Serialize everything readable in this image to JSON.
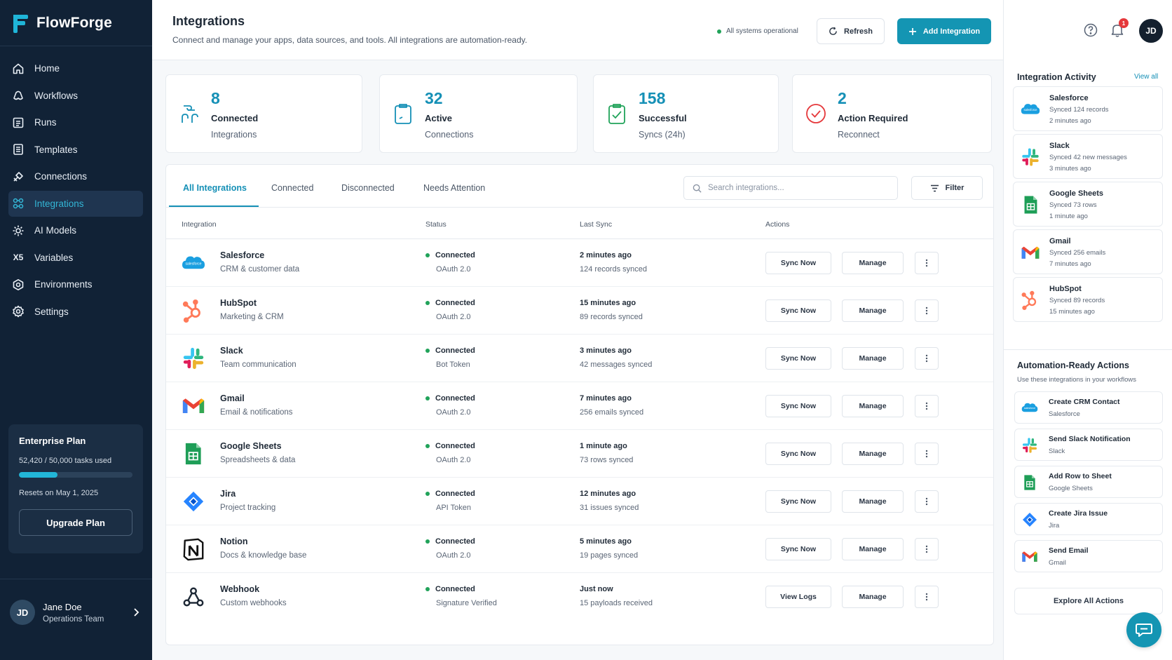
{
  "app": {
    "name": "FlowForge",
    "accent": "#1590b6",
    "sidebar_bg": "#112236"
  },
  "nav": [
    {
      "label": "Home",
      "icon": "home-icon",
      "active": false
    },
    {
      "label": "Workflows",
      "icon": "workflows-icon",
      "active": false
    },
    {
      "label": "Runs",
      "icon": "runs-icon",
      "active": false
    },
    {
      "label": "Templates",
      "icon": "templates-icon",
      "active": false
    },
    {
      "label": "Connections",
      "icon": "connections-icon",
      "active": false
    },
    {
      "label": "Integrations",
      "icon": "integrations-icon",
      "active": true
    },
    {
      "label": "AI Models",
      "icon": "ai-models-icon",
      "active": false
    },
    {
      "label": "Variables",
      "icon": "variables-icon",
      "glyph": "X5",
      "active": false
    },
    {
      "label": "Environments",
      "icon": "environments-icon",
      "active": false
    },
    {
      "label": "Settings",
      "icon": "settings-icon",
      "active": false
    }
  ],
  "plan": {
    "title": "Enterprise Plan",
    "usage": "52,420 / 50,000 tasks used",
    "progress_fraction": 0.34,
    "reset": "Resets on May 1, 2025",
    "button": "Upgrade Plan"
  },
  "user": {
    "initials": "JD",
    "name": "Jane Doe",
    "team": "Operations Team"
  },
  "header": {
    "title": "Integrations",
    "subtitle": "Connect and manage your apps, data sources, and tools. All integrations are automation-ready.",
    "status": "All systems operational",
    "refresh": "Refresh",
    "add": "Add Integration",
    "notifications": "1",
    "avatar": "JD"
  },
  "stats": [
    {
      "value": "8",
      "label": "Connected",
      "sub": "Integrations",
      "icon": "link-icon"
    },
    {
      "value": "32",
      "label": "Active",
      "sub": "Connections",
      "icon": "clipboard-icon"
    },
    {
      "value": "158",
      "label": "Successful",
      "sub": "Syncs (24h)",
      "icon": "clipboard-check-icon"
    },
    {
      "value": "2",
      "label": "Action Required",
      "sub": "Reconnect",
      "icon": "check-circle-icon"
    }
  ],
  "tabs": [
    "All Integrations",
    "Connected",
    "Disconnected",
    "Needs Attention"
  ],
  "search_placeholder": "Search integrations...",
  "filter": "Filter",
  "columns": [
    "Integration",
    "Status",
    "Last Sync",
    "Actions"
  ],
  "rows": [
    {
      "name": "Salesforce",
      "desc": "CRM & customer data",
      "status": "Connected",
      "auth": "OAuth 2.0",
      "sync": "2 minutes ago",
      "synced": "124 records synced",
      "action": "Sync Now",
      "manage": "Manage",
      "logo": "salesforce"
    },
    {
      "name": "HubSpot",
      "desc": "Marketing & CRM",
      "status": "Connected",
      "auth": "OAuth 2.0",
      "sync": "15 minutes ago",
      "synced": "89 records synced",
      "action": "Sync Now",
      "manage": "Manage",
      "logo": "hubspot"
    },
    {
      "name": "Slack",
      "desc": "Team communication",
      "status": "Connected",
      "auth": "Bot Token",
      "sync": "3 minutes ago",
      "synced": "42 messages synced",
      "action": "Sync Now",
      "manage": "Manage",
      "logo": "slack"
    },
    {
      "name": "Gmail",
      "desc": "Email & notifications",
      "status": "Connected",
      "auth": "OAuth 2.0",
      "sync": "7 minutes ago",
      "synced": "256 emails synced",
      "action": "Sync Now",
      "manage": "Manage",
      "logo": "gmail"
    },
    {
      "name": "Google Sheets",
      "desc": "Spreadsheets & data",
      "status": "Connected",
      "auth": "OAuth 2.0",
      "sync": "1 minute ago",
      "synced": "73 rows synced",
      "action": "Sync Now",
      "manage": "Manage",
      "logo": "sheets"
    },
    {
      "name": "Jira",
      "desc": "Project tracking",
      "status": "Connected",
      "auth": "API Token",
      "sync": "12 minutes ago",
      "synced": "31 issues synced",
      "action": "Sync Now",
      "manage": "Manage",
      "logo": "jira"
    },
    {
      "name": "Notion",
      "desc": "Docs & knowledge base",
      "status": "Connected",
      "auth": "OAuth 2.0",
      "sync": "5 minutes ago",
      "synced": "19 pages synced",
      "action": "Sync Now",
      "manage": "Manage",
      "logo": "notion"
    },
    {
      "name": "Webhook",
      "desc": "Custom webhooks",
      "status": "Connected",
      "auth": "Signature Verified",
      "sync": "Just now",
      "synced": "15 payloads received",
      "action": "View Logs",
      "manage": "Manage",
      "logo": "webhook"
    }
  ],
  "activity": {
    "title": "Integration Activity",
    "view_all": "View all",
    "items": [
      {
        "name": "Salesforce",
        "desc": "Synced 124 records",
        "time": "2 minutes ago",
        "logo": "salesforce"
      },
      {
        "name": "Slack",
        "desc": "Synced 42 new messages",
        "time": "3 minutes ago",
        "logo": "slack"
      },
      {
        "name": "Google Sheets",
        "desc": "Synced 73 rows",
        "time": "1 minute ago",
        "logo": "sheets"
      },
      {
        "name": "Gmail",
        "desc": "Synced 256 emails",
        "time": "7 minutes ago",
        "logo": "gmail"
      },
      {
        "name": "HubSpot",
        "desc": "Synced 89 records",
        "time": "15 minutes ago",
        "logo": "hubspot"
      }
    ]
  },
  "actions": {
    "title": "Automation-Ready Actions",
    "subtitle": "Use these integrations in your workflows",
    "items": [
      {
        "name": "Create CRM Contact",
        "source": "Salesforce",
        "logo": "salesforce"
      },
      {
        "name": "Send Slack Notification",
        "source": "Slack",
        "logo": "slack"
      },
      {
        "name": "Add Row to Sheet",
        "source": "Google Sheets",
        "logo": "sheets"
      },
      {
        "name": "Create Jira Issue",
        "source": "Jira",
        "logo": "jira"
      },
      {
        "name": "Send Email",
        "source": "Gmail",
        "logo": "gmail"
      }
    ],
    "explore": "Explore All Actions"
  },
  "salesforce_logo_text": "salesforce"
}
